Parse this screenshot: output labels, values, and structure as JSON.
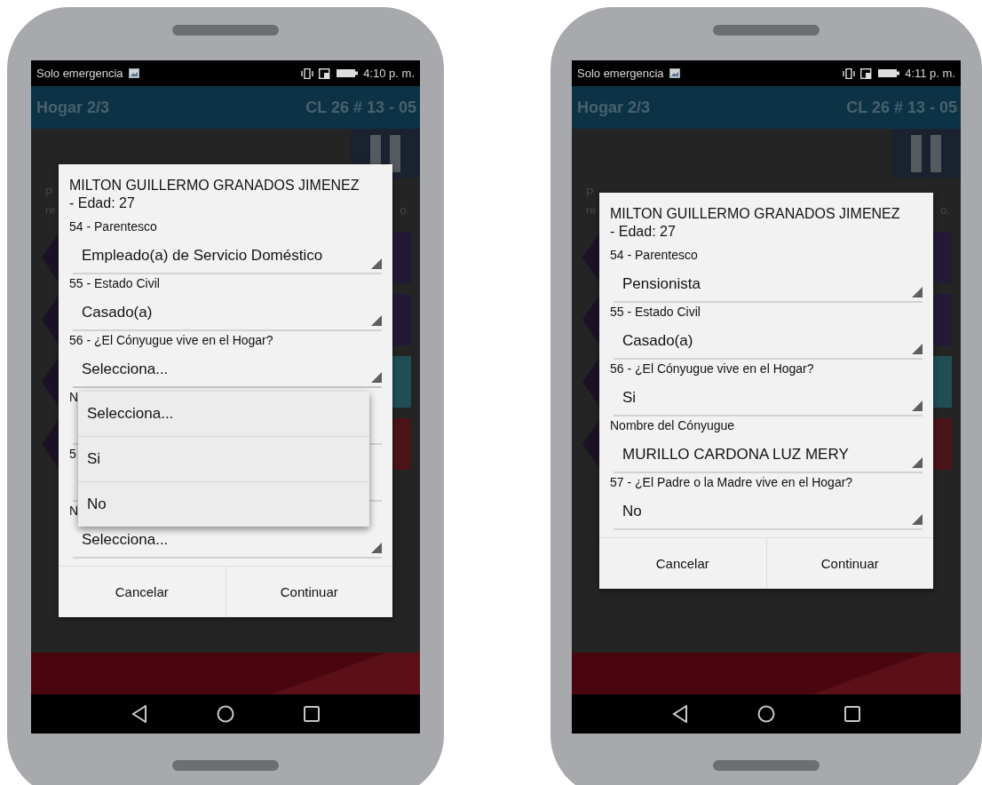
{
  "phones": [
    {
      "status_bar": {
        "carrier": "Solo emergencia",
        "time": "4:10 p. m."
      },
      "app_bar": {
        "title": "Hogar 2/3",
        "address": "CL 26 # 13 - 05"
      },
      "background_texts": {
        "left": [
          "P",
          "re"
        ],
        "right": "o."
      },
      "dialog": {
        "name": "MILTON GUILLERMO GRANADOS JIMENEZ",
        "age": "- Edad: 27",
        "fields": [
          {
            "label": "54 - Parentesco",
            "value": "Empleado(a) de Servicio Doméstico",
            "expanded": false
          },
          {
            "label": "55 - Estado Civil",
            "value": "Casado(a)",
            "expanded": false
          },
          {
            "label": "56 - ¿El Cónyugue vive en el Hogar?",
            "value": "Selecciona...",
            "expanded": true,
            "options": [
              "Selecciona...",
              "Si",
              "No"
            ]
          },
          {
            "label": "N",
            "expanded": false
          },
          {
            "label": "5",
            "expanded": false
          },
          {
            "label": "N",
            "value": "Selecciona...",
            "expanded": false
          }
        ],
        "buttons": [
          "Cancelar",
          "Continuar"
        ]
      }
    },
    {
      "status_bar": {
        "carrier": "Solo emergencia",
        "time": "4:11 p. m."
      },
      "app_bar": {
        "title": "Hogar 2/3",
        "address": "CL 26 # 13 - 05"
      },
      "background_texts": {
        "left": [
          "P",
          "re"
        ],
        "right": "o."
      },
      "dialog": {
        "name": "MILTON GUILLERMO GRANADOS JIMENEZ",
        "age": "- Edad: 27",
        "fields": [
          {
            "label": "54 - Parentesco",
            "value": "Pensionista",
            "expanded": false
          },
          {
            "label": "55 - Estado Civil",
            "value": "Casado(a)",
            "expanded": false
          },
          {
            "label": "56 - ¿El Cónyugue vive en el Hogar?",
            "value": "Si",
            "expanded": false
          },
          {
            "label": "Nombre del Cónyugue",
            "value": "MURILLO CARDONA LUZ MERY",
            "expanded": false
          },
          {
            "label": "57 - ¿El Padre o la Madre vive en el Hogar?",
            "value": "No",
            "expanded": false
          }
        ],
        "buttons": [
          "Cancelar",
          "Continuar"
        ]
      }
    }
  ]
}
